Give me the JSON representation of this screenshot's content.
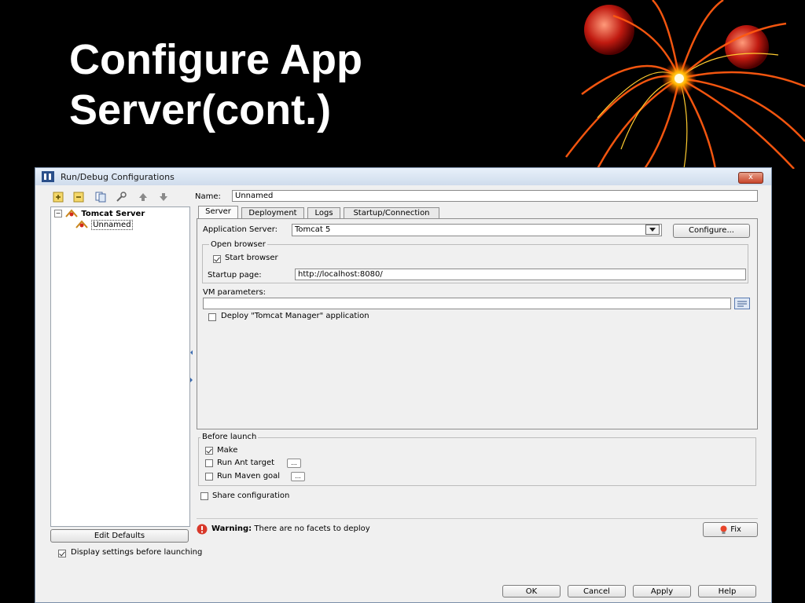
{
  "slide": {
    "title_line1": "Configure App",
    "title_line2": "Server(cont.)"
  },
  "window": {
    "title": "Run/Debug Configurations",
    "close_label": "x"
  },
  "tree": {
    "root_label": "Tomcat Server",
    "child_label": "Unnamed"
  },
  "left": {
    "edit_defaults_label": "Edit Defaults",
    "display_settings_label": "Display settings before launching"
  },
  "name_field": {
    "label": "Name:",
    "value": "Unnamed"
  },
  "tabs": [
    {
      "label": "Server"
    },
    {
      "label": "Deployment"
    },
    {
      "label": "Logs"
    },
    {
      "label": "Startup/Connection"
    }
  ],
  "server": {
    "app_server_label": "Application Server:",
    "app_server_value": "Tomcat 5",
    "configure_label": "Configure...",
    "open_browser_group": "Open browser",
    "start_browser_label": "Start browser",
    "startup_page_label": "Startup page:",
    "startup_page_value": "http://localhost:8080/",
    "vm_params_label": "VM parameters:",
    "vm_params_value": "",
    "deploy_manager_label": "Deploy \"Tomcat Manager\" application"
  },
  "before_launch": {
    "group_title": "Before launch",
    "make_label": "Make",
    "ant_label": "Run Ant target",
    "maven_label": "Run Maven goal",
    "dots": "..."
  },
  "share_label": "Share configuration",
  "warning": {
    "bold": "Warning:",
    "text": "There are no facets to deploy",
    "fix_label": "Fix"
  },
  "footer": {
    "ok": "OK",
    "cancel": "Cancel",
    "apply": "Apply",
    "help": "Help"
  }
}
